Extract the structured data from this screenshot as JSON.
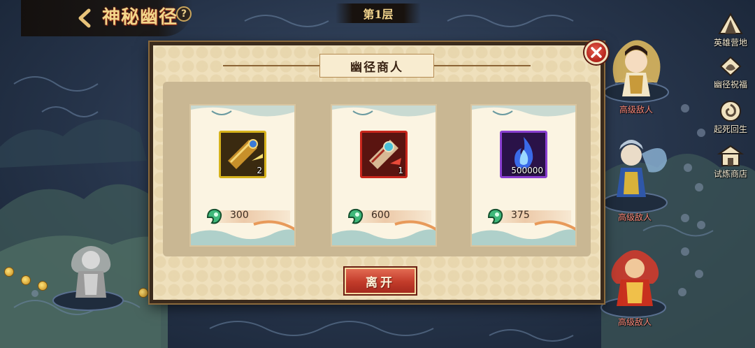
{
  "header": {
    "title": "神秘幽径",
    "help_symbol": "?",
    "floor": "第1层"
  },
  "side_menu": [
    {
      "label": "英雄营地",
      "icon": "tent-icon"
    },
    {
      "label": "幽径祝福",
      "icon": "blessing-icon"
    },
    {
      "label": "起死回生",
      "icon": "revive-icon"
    },
    {
      "label": "试炼商店",
      "icon": "shop-icon"
    }
  ],
  "enemies": [
    {
      "label": "高级敌人"
    },
    {
      "label": "高级敌人"
    },
    {
      "label": "高级敌人"
    }
  ],
  "shop": {
    "title": "幽径商人",
    "leave_label": "离开",
    "items": [
      {
        "name": "gold-scroll",
        "count": "2",
        "price": "300",
        "frame_color": "#d6b21c"
      },
      {
        "name": "red-scroll",
        "count": "1",
        "price": "600",
        "frame_color": "#c8261c"
      },
      {
        "name": "blue-soul-flame",
        "count": "500000",
        "price": "375",
        "frame_color": "#8a3fd0"
      }
    ]
  },
  "colors": {
    "accent_gold": "#f2d58a",
    "button_red": "#c23b2a",
    "panel": "#efe0bc"
  }
}
